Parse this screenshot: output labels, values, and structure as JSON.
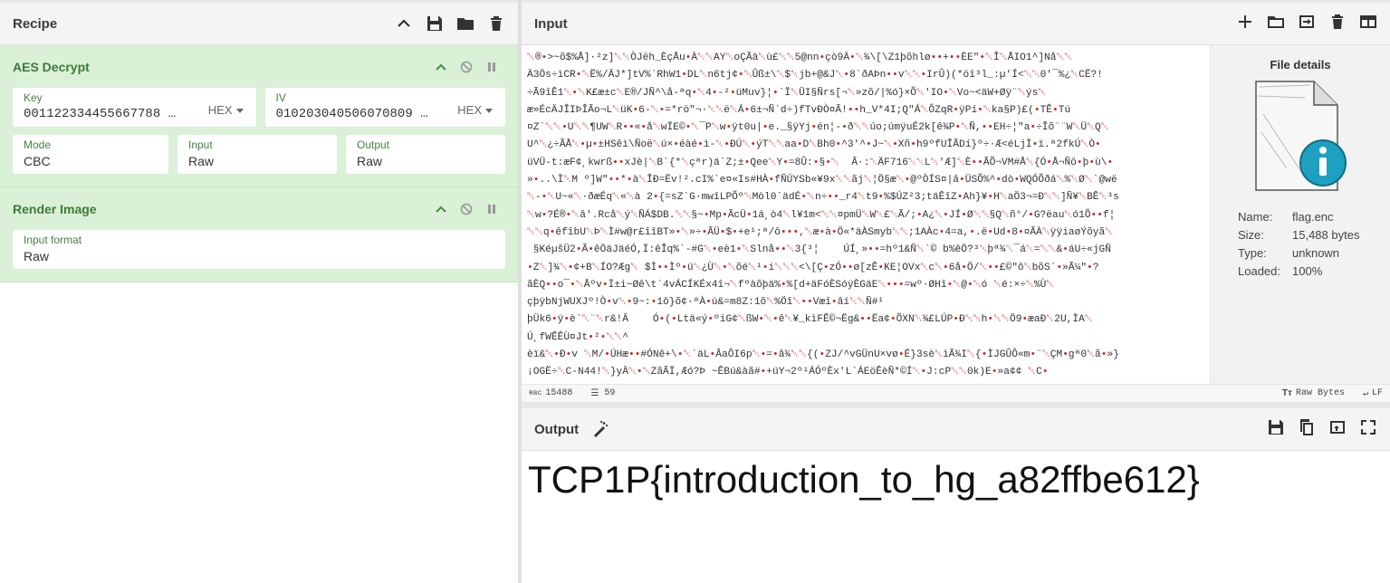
{
  "recipe": {
    "title": "Recipe",
    "ops": [
      {
        "name": "AES Decrypt",
        "key_label": "Key",
        "key_value": "001122334455667788 …",
        "key_format": "HEX",
        "iv_label": "IV",
        "iv_value": "010203040506070809 …",
        "iv_format": "HEX",
        "mode_label": "Mode",
        "mode_value": "CBC",
        "input_label": "Input",
        "input_value": "Raw",
        "output_label": "Output",
        "output_value": "Raw"
      },
      {
        "name": "Render Image",
        "format_label": "Input format",
        "format_value": "Raw"
      }
    ]
  },
  "input": {
    "title": "Input",
    "lines": [
      "␀®•>~õ$%Å]·²z]␀␀ÒJëh_ÈçÅu•À␀␀AY␀oÇÃà␀ù£␀␀5@nn•çò9Ä•␀¾\\[\\Z1þõhlø••+••ÈE\"•␀Î␀ÅIO1^]Nå␀␀",
      "Ä3Ös÷ìCR•␀Ë%/ÄJ*]tV%`RhW1•DL␀n6tj¢•␀Ûß±\\␀$␀jb+@&J␀•8`ðAÞn••v␀␀•IrÛ)(*öî³l_:µ'Í<␀␀0'¯%¿␀CË?!",
      "÷Ã9îÊ1␀•␀K£æ±c␀E®/JÑ^\\å-ªq•␀4•-²•üMuv}¦•`Ï␀ÜI§Ñrs[¬␀»zõ/|%ó}×Õ␀'IO•␀Vo~<äW+Øÿ¨␀ýs␀",
      "æ»ÉcÄJÎIÞÎÃo¬L␀üK•6-␀•=*rö\"¬·␀␀ë␀Á•6±¬Ñ`d÷)fTvÐÒ¤Ã!••h_V*4I;Q\"Á␀ÔZqR•ÿPí•␀ka§P)£(•TÊ•Tú",
      "¤Z`␀␀•U␀␀¶UW␀R••«•å␀wÏE©•␀¯P␀w•ÿt0u|•e._§ÿYj•én¦-•ð␀␀úo;úmÿuÉ2k[ê¾P•␀Ñ,••EH÷¦\"a•÷Îõ¨¨W␀Ü␀Q␀",
      "U^␀¿÷ÃÅ␀•µ•±HSêì\\Ñoë␀ú×•éàé•ì-␀•ÐÚ␀•ýT␀␀aa•D␀Bh0•^3'^•J~␀•X­ñ•h9ºfUÎÃDí}º÷·Æ<éLjÌ•ï.ª2fkÚ␀Ò•",
      "üVÜ-t:æF¢¸kwrß••xJè|␀B`{*␀çªr)ä`Z;±•Qee␀Y•=8Û:•§•␀  Ã·:␀ÄF716␀␀L␀'Æ]␀È••ÃÕ¬VM#Å␀{Ó•Å¬Ñö•þ•ù\\•",
      "»•..\\Ì␀M º]W\"••*•à␀ÎÐ=Ëv!².cI%`e¤«Is#HÀ•fÑÚYSb«¥9x␀␀ãj␀¦Ö§æ␀•@ºÒÍS¤|â•ÜSÕ%^•dò•WQÓÕðá␀%␀Ø␀`@wë",
      "␀-•␀U~«␀·ðæÉq␀«␀à 2•{=sZ`G·mwîLPÕº␀Mòl0`ädÉ•␀n÷••_r4␀t9•%$ÚZ²3;täÊîZ•Ah}¥•H␀aÖ3¬=Ð␀␀]Ñ¥␀BÊ␀³s",
      "␀w•?É®•␀â'.Rcå␀ý␀ÑÁ$DB.␀␀§~•Mp•ÃcÜ•1á¸ò4␀l¥1m<␀␀¤pmÜ␀W␀£␀Ã/;•A¿␀•JÍ•Ø␀␀§Q␀ñ°/•G?ëau␀ó1Õ••f¦",
      "␀␀q•êfîbU␀Þ␀Ì#w@r£îîBT»•␀»÷•ÃÜ•$•+e¹;ª/ô•••,␀æ•à•Ö«*äÀSmyb␀␀;1AÀc•4=a,•.ë•Ud•8•¤ÃÀ␀ÿÿiaøÝõyã␀",
      " §KéµšÜ2•Ã•êÖäJäéÓ,Ï:êÎq%`-#G␀•eè1•␀Slnå••␀3{³¦    ÚÍ¸»••=hº1&Ñ␀`© b%êÖ?³␀þª¾␀¯á␀=␀␀&•áU÷«jGÑ",
      "•Z␀]¾␀•¢+B␀ÍO?Æg␀ $Ì••Ìº•ü␀¿Ù␀•␀õé␀¹•i␀␀␀<\\[Ç•zÓ••ø[zÊ•KE¦OVx␀c␀•6å•Ö/␀••£©\"ô␀bõS`•»Ã¼\"•?",
      "ãÈQ••o¯•␀Åºv•Ï±i~Øê\\t`4vÁCÍKÉx4î¬␀fºàõþä%•%[d+äFóÈSóÿÈGäE␀•••=wº·ØHî•␀@•␀ó ␀é:×÷␀%Ù␀",
      "çþÿbNjWUXJº!Ò•v␀•9~:•1ô}õ¢·ªÀ•ú&=m8Z:1õ␀%Öî␀••Væî•âí␀␀Ñ#¹",
      "þÜk6•ÿ•è`␀¨␀r&!Ä    Ó•(•Ltä«ý•ºiG¢␀ßW•␀•ê␀¥_kìFÊ©¬Ëg&••Ëa¢•ÕXN␀¾£LÚP•Ð␀␀h•␀␀Ö9•æaÐ␀2U,ÌA␀",
      "Ú¸fWÊÊÙ¤Jt•²•␀␀^",
      "èï&␀•Ð•v ␀M/•ÚHæ••#ÓNê+\\•␀`äL•ÂaÔI6p␀•=•â¾␀␀{(•ZJ/^vGÜnU×vø•É}3sè␀ìÃ¾I␀{•ÌJGÛÔ«m•¨␀ÇM•gª0␀ã•»}",
      "¡OGË÷␀C-N44!␀}yÄ␀•␀ZãÃÏ,Æó?Þ ~ÊBú&àã#•+üY¬2º¹ÁÓºÈx'L`ÁEöÊèÑ*©Í␀•J:cP␀␀0k)E•»a¢¢ ␀C•"
    ],
    "status": {
      "chars_label": "ʀʙᴄ",
      "chars": "15488",
      "lines_icon": "lines-icon",
      "lines": "59",
      "raw_bytes": "Raw Bytes",
      "eol": "LF"
    },
    "file_details": {
      "title": "File details",
      "name_label": "Name:",
      "name": "flag.enc",
      "size_label": "Size:",
      "size": "15,488 bytes",
      "type_label": "Type:",
      "type": "unknown",
      "loaded_label": "Loaded:",
      "loaded": "100%"
    }
  },
  "output": {
    "title": "Output",
    "text": "TCP1P{introduction_to_hg_a82ffbe612}"
  },
  "colors": {
    "op_bg": "#daf0d7",
    "op_title": "#3d7a3a",
    "control_char": "#d21f1f",
    "file_icon_accent": "#1ea1c0"
  }
}
